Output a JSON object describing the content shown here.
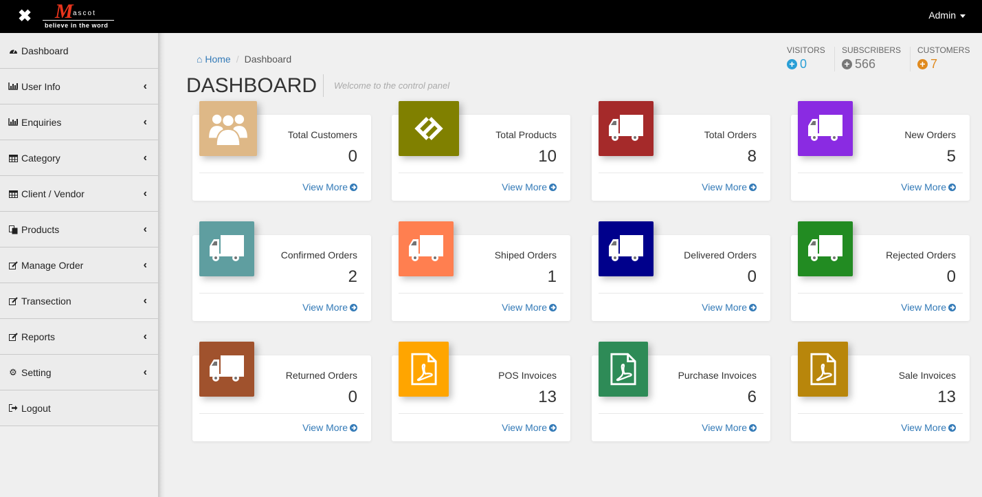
{
  "header": {
    "logo_letter": "M",
    "logo_brand": "ascot",
    "logo_tagline": "believe in the word",
    "user_label": "Admin"
  },
  "sidebar": {
    "items": [
      {
        "label": "Dashboard",
        "icon": "dashboard-icon"
      },
      {
        "label": "User Info",
        "icon": "bar-chart-icon"
      },
      {
        "label": "Enquiries",
        "icon": "bar-chart-icon"
      },
      {
        "label": "Category",
        "icon": "calendar-icon"
      },
      {
        "label": "Client / Vendor",
        "icon": "calendar-icon"
      },
      {
        "label": "Products",
        "icon": "copy-icon"
      },
      {
        "label": "Manage Order",
        "icon": "edit-icon"
      },
      {
        "label": "Transection",
        "icon": "edit-icon"
      },
      {
        "label": "Reports",
        "icon": "edit-icon"
      },
      {
        "label": "Setting",
        "icon": "gear-icon"
      },
      {
        "label": "Logout",
        "icon": "sign-out-icon"
      }
    ]
  },
  "breadcrumb": {
    "home": "Home",
    "current": "Dashboard"
  },
  "page": {
    "title": "DASHBOARD",
    "subtitle": "Welcome to the control panel"
  },
  "stats": [
    {
      "label": "VISITORS",
      "value": "0",
      "color": "#2a9fd6"
    },
    {
      "label": "SUBSCRIBERS",
      "value": "566",
      "color": "#777777"
    },
    {
      "label": "CUSTOMERS",
      "value": "7",
      "color": "#e08a1e"
    }
  ],
  "cards": [
    {
      "title": "Total Customers",
      "value": "0",
      "more": "View More",
      "color": "#deb887",
      "icon": "users-icon"
    },
    {
      "title": "Total Products",
      "value": "10",
      "more": "View More",
      "color": "#808000",
      "icon": "link-icon"
    },
    {
      "title": "Total Orders",
      "value": "8",
      "more": "View More",
      "color": "#a52a2a",
      "icon": "truck-icon"
    },
    {
      "title": "New Orders",
      "value": "5",
      "more": "View More",
      "color": "#8a2be2",
      "icon": "truck-icon"
    },
    {
      "title": "Confirmed Orders",
      "value": "2",
      "more": "View More",
      "color": "#5f9ea0",
      "icon": "truck-icon"
    },
    {
      "title": "Shiped Orders",
      "value": "1",
      "more": "View More",
      "color": "#ff7f50",
      "icon": "truck-icon"
    },
    {
      "title": "Delivered Orders",
      "value": "0",
      "more": "View More",
      "color": "#00008b",
      "icon": "truck-icon"
    },
    {
      "title": "Rejected Orders",
      "value": "0",
      "more": "View More",
      "color": "#228b22",
      "icon": "truck-icon"
    },
    {
      "title": "Returned Orders",
      "value": "0",
      "more": "View More",
      "color": "#a0522d",
      "icon": "truck-icon"
    },
    {
      "title": "POS Invoices",
      "value": "13",
      "more": "View More",
      "color": "#ffa500",
      "icon": "pdf-icon"
    },
    {
      "title": "Purchase Invoices",
      "value": "6",
      "more": "View More",
      "color": "#2e8b57",
      "icon": "pdf-icon"
    },
    {
      "title": "Sale Invoices",
      "value": "13",
      "more": "View More",
      "color": "#b8860b",
      "icon": "pdf-icon"
    }
  ]
}
